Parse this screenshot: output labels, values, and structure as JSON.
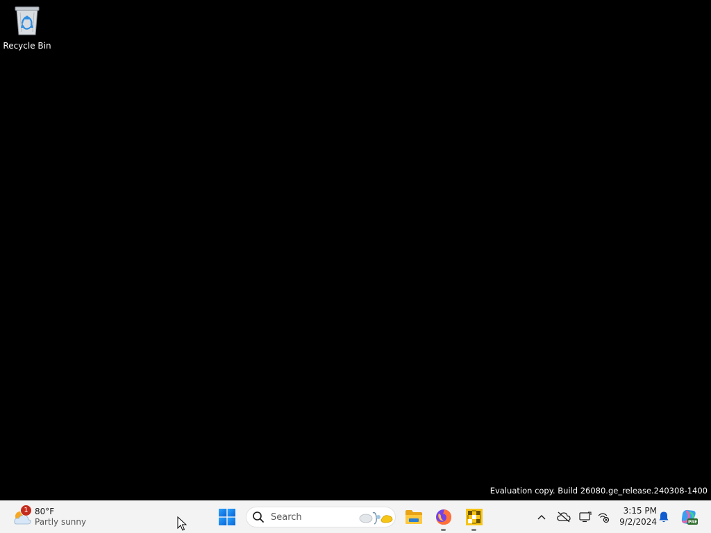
{
  "desktop": {
    "icons": [
      {
        "label": "Recycle Bin",
        "icon": "recycle-bin-icon"
      }
    ],
    "watermark": "Evaluation copy. Build 26080.ge_release.240308-1400",
    "background_color": "#000000"
  },
  "taskbar": {
    "background_color": "#f3f3f3",
    "weather": {
      "temperature": "80°F",
      "condition": "Partly sunny",
      "badge_count": "1",
      "icon": "partly-sunny-icon"
    },
    "start": {
      "icon": "windows-logo-icon"
    },
    "search": {
      "placeholder": "Search",
      "icon": "search-icon"
    },
    "apps": [
      {
        "name": "File Explorer",
        "icon": "folder-icon"
      },
      {
        "name": "Firefox",
        "icon": "firefox-icon",
        "running": true
      },
      {
        "name": "App",
        "icon": "tiles-app-icon",
        "running": true
      }
    ],
    "tray": {
      "icons": [
        "chevron-up-icon",
        "cloud-offline-icon",
        "display-icon",
        "network-disconnected-icon"
      ],
      "time": "3:15 PM",
      "date": "9/2/2024",
      "notification_icon": "bell-icon",
      "copilot_icon": "copilot-pre-icon",
      "copilot_badge": "PRE"
    }
  }
}
